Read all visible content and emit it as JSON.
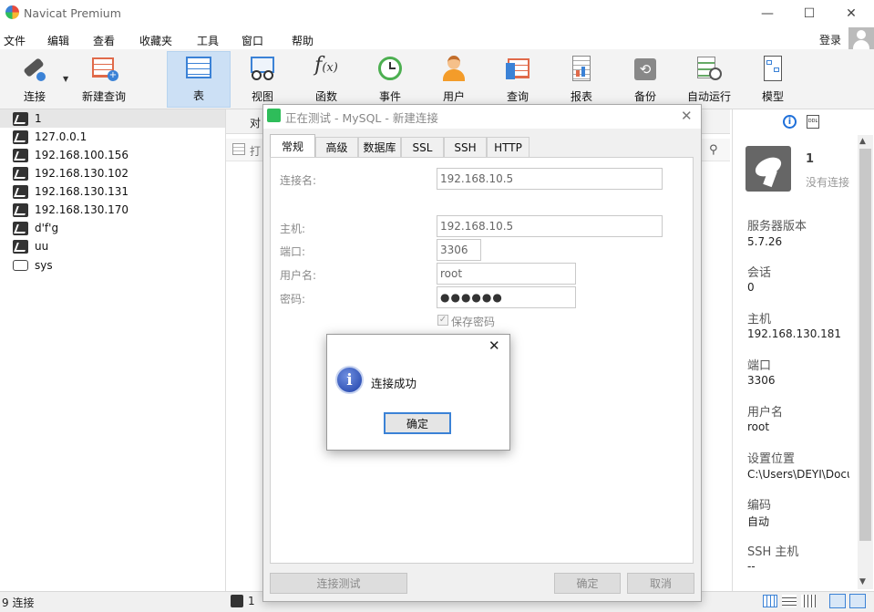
{
  "app": {
    "title": "Navicat Premium",
    "login": "登录"
  },
  "window_controls": {
    "minimize": "—",
    "maximize": "☐",
    "close": "✕"
  },
  "menu": [
    "文件",
    "编辑",
    "查看",
    "收藏夹",
    "工具",
    "窗口",
    "帮助"
  ],
  "toolbar": {
    "connect": "连接",
    "new_query": "新建查询",
    "table": "表",
    "view": "视图",
    "function": "函数",
    "event": "事件",
    "user": "用户",
    "query": "查询",
    "report": "报表",
    "backup": "备份",
    "automation": "自动运行",
    "model": "模型"
  },
  "sidebar": {
    "items": [
      "1",
      "127.0.0.1",
      "192.168.100.156",
      "192.168.130.102",
      "192.168.130.131",
      "192.168.130.170",
      "d'f'g",
      "uu",
      "sys"
    ]
  },
  "center": {
    "tab_partial": "对",
    "open_partial": "打"
  },
  "dialog": {
    "title": "正在测试 - MySQL - 新建连接",
    "tabs": [
      "常规",
      "高级",
      "数据库",
      "SSL",
      "SSH",
      "HTTP"
    ],
    "fields": {
      "conn_name_label": "连接名:",
      "conn_name": "192.168.10.5",
      "host_label": "主机:",
      "host": "192.168.10.5",
      "port_label": "端口:",
      "port": "3306",
      "user_label": "用户名:",
      "user": "root",
      "pwd_label": "密码:",
      "pwd": "●●●●●●",
      "save_pwd": "保存密码"
    },
    "buttons": {
      "test": "连接测试",
      "ok": "确定",
      "cancel": "取消"
    }
  },
  "msgbox": {
    "message": "连接成功",
    "ok": "确定",
    "close": "✕"
  },
  "rightpanel": {
    "name": "1",
    "status": "没有连接",
    "fields": [
      {
        "label": "服务器版本",
        "value": "5.7.26"
      },
      {
        "label": "会话",
        "value": "0"
      },
      {
        "label": "主机",
        "value": "192.168.130.181"
      },
      {
        "label": "端口",
        "value": "3306"
      },
      {
        "label": "用户名",
        "value": "root"
      },
      {
        "label": "设置位置",
        "value": "C:\\Users\\DEYI\\Docu"
      },
      {
        "label": "编码",
        "value": "自动"
      },
      {
        "label": "SSH 主机",
        "value": "--"
      }
    ]
  },
  "statusbar": {
    "count": "9 连接",
    "tab": "1"
  },
  "colors": {
    "accent": "#3b82d6",
    "toolbar_active": "#cce0f5"
  }
}
